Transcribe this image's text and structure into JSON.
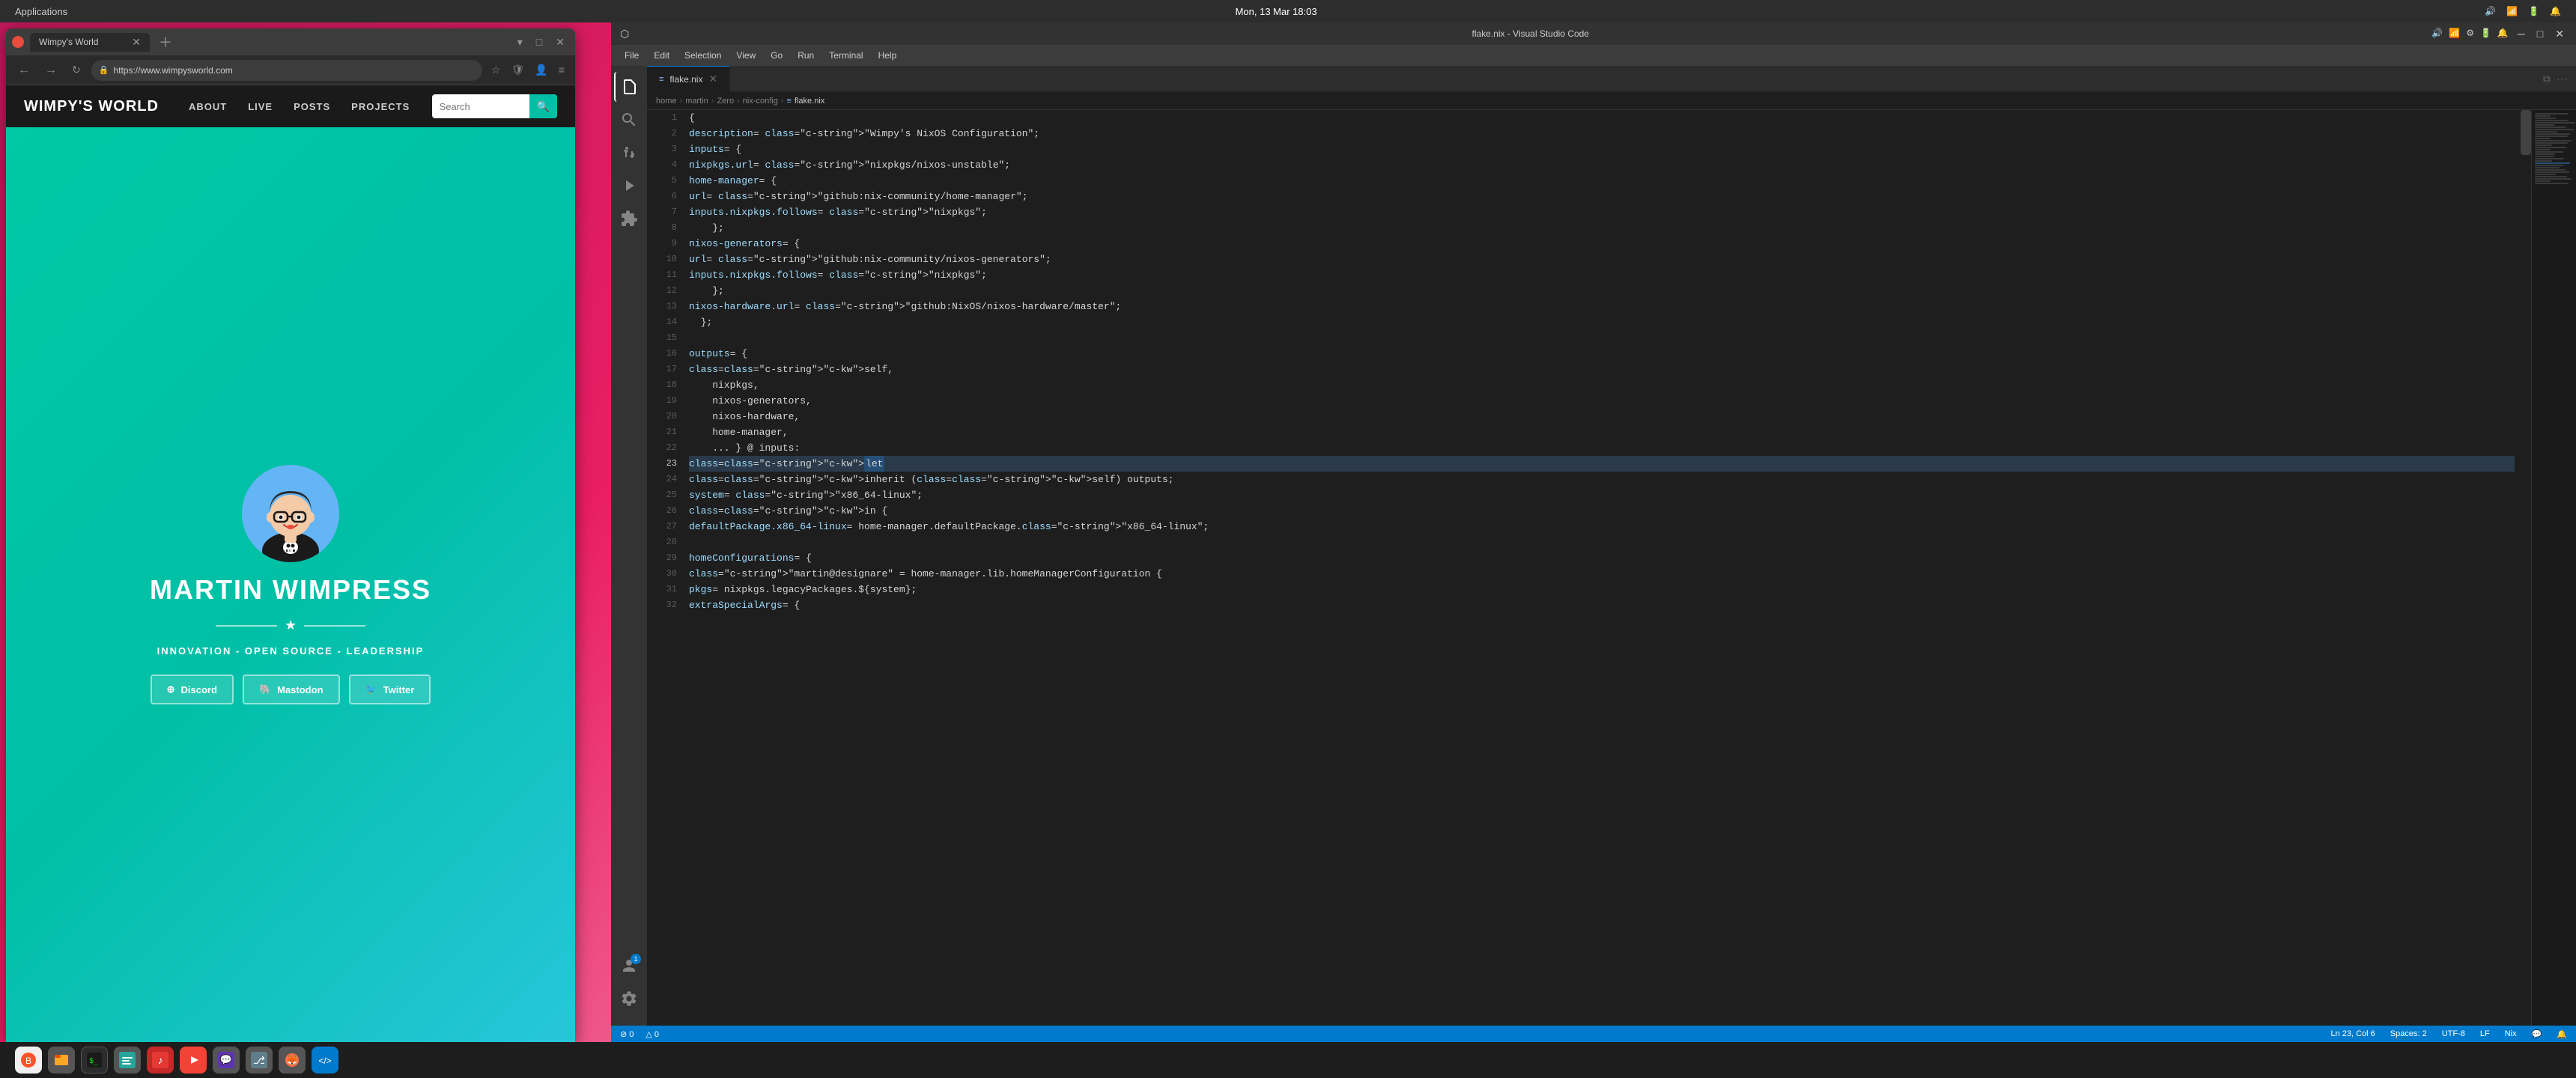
{
  "system": {
    "appname": "Applications",
    "datetime": "Mon, 13 Mar   18:03",
    "audio_icon": "🔊",
    "battery_icon": "🔋",
    "wifi_icon": "📶",
    "bell_icon": "🔔"
  },
  "browser": {
    "favicon": "🦊",
    "tab_title": "Wimpy's World",
    "url": "https://www.wimpysworld.com",
    "search_placeholder": "Search"
  },
  "website": {
    "logo": "WIMPY'S WORLD",
    "nav": {
      "about": "ABOUT",
      "live": "LIVE",
      "posts": "POSTS",
      "projects": "PROJECTS"
    },
    "hero": {
      "name": "MARTIN WIMPRESS",
      "tagline": "INNOVATION - OPEN SOURCE - LEADERSHIP",
      "discord_label": "Discord",
      "mastodon_label": "Mastodon",
      "twitter_label": "Twitter"
    }
  },
  "vscode": {
    "title": "flake.nix - Visual Studio Code",
    "menu": {
      "file": "File",
      "edit": "Edit",
      "selection": "Selection",
      "view": "View",
      "go": "Go",
      "run": "Run",
      "terminal": "Terminal",
      "help": "Help"
    },
    "tab": {
      "filename": "flake.nix"
    },
    "breadcrumb": {
      "home": "home",
      "martin": "martin",
      "zero": "Zero",
      "nix_config": "nix-config",
      "file": "flake.nix"
    },
    "statusbar": {
      "errors": "⊘ 0",
      "warnings": "△ 0",
      "line_col": "Ln 23, Col 6",
      "spaces": "Spaces: 2",
      "encoding": "UTF-8",
      "line_ending": "LF",
      "language": "Nix",
      "notifications": "🔔",
      "feedback": "💬"
    },
    "code_lines": [
      {
        "num": 1,
        "content": "{"
      },
      {
        "num": 2,
        "content": "  description = \"Wimpy's NixOS Configuration\";"
      },
      {
        "num": 3,
        "content": "  inputs = {"
      },
      {
        "num": 4,
        "content": "    nixpkgs.url = \"nixpkgs/nixos-unstable\";"
      },
      {
        "num": 5,
        "content": "    home-manager = {"
      },
      {
        "num": 6,
        "content": "      url = \"github:nix-community/home-manager\";"
      },
      {
        "num": 7,
        "content": "      inputs.nixpkgs.follows = \"nixpkgs\";"
      },
      {
        "num": 8,
        "content": "    };"
      },
      {
        "num": 9,
        "content": "    nixos-generators = {"
      },
      {
        "num": 10,
        "content": "      url = \"github:nix-community/nixos-generators\";"
      },
      {
        "num": 11,
        "content": "      inputs.nixpkgs.follows = \"nixpkgs\";"
      },
      {
        "num": 12,
        "content": "    };"
      },
      {
        "num": 13,
        "content": "    nixos-hardware.url = \"github:NixOS/nixos-hardware/master\";"
      },
      {
        "num": 14,
        "content": "  };"
      },
      {
        "num": 15,
        "content": ""
      },
      {
        "num": 16,
        "content": "  outputs = {"
      },
      {
        "num": 17,
        "content": "    self,"
      },
      {
        "num": 18,
        "content": "    nixpkgs,"
      },
      {
        "num": 19,
        "content": "    nixos-generators,"
      },
      {
        "num": 20,
        "content": "    nixos-hardware,"
      },
      {
        "num": 21,
        "content": "    home-manager,"
      },
      {
        "num": 22,
        "content": "    ... } @ inputs:"
      },
      {
        "num": 23,
        "content": "    let",
        "highlighted": true
      },
      {
        "num": 24,
        "content": "      inherit (self) outputs;"
      },
      {
        "num": 25,
        "content": "      system = \"x86_64-linux\";"
      },
      {
        "num": 26,
        "content": "    in {"
      },
      {
        "num": 27,
        "content": "      defaultPackage.x86_64-linux = home-manager.defaultPackage.\"x86_64-linux\";"
      },
      {
        "num": 28,
        "content": ""
      },
      {
        "num": 29,
        "content": "      homeConfigurations = {"
      },
      {
        "num": 30,
        "content": "        \"martin@designare\" = home-manager.lib.homeManagerConfiguration {"
      },
      {
        "num": 31,
        "content": "          pkgs = nixpkgs.legacyPackages.${system};"
      },
      {
        "num": 32,
        "content": "          extraSpecialArgs = {"
      }
    ]
  },
  "taskbar": {
    "icons": [
      {
        "name": "brave-browser",
        "symbol": "🦁",
        "color": "#fb542b"
      },
      {
        "name": "file-manager",
        "symbol": "📁",
        "color": "#f9a825"
      },
      {
        "name": "terminal",
        "symbol": "⬛",
        "color": "#333"
      },
      {
        "name": "text-editor",
        "symbol": "📝",
        "color": "#26a69a"
      },
      {
        "name": "music",
        "symbol": "🎵",
        "color": "#e91e63"
      },
      {
        "name": "youtube",
        "symbol": "▶",
        "color": "#f44336"
      },
      {
        "name": "chat",
        "symbol": "💬",
        "color": "#7c4dff"
      },
      {
        "name": "source-control",
        "symbol": "⬡",
        "color": "#607d8b"
      },
      {
        "name": "firefox",
        "symbol": "🦊",
        "color": "#ff7043"
      },
      {
        "name": "vscode",
        "symbol": "⬡",
        "color": "#007acc"
      }
    ]
  }
}
